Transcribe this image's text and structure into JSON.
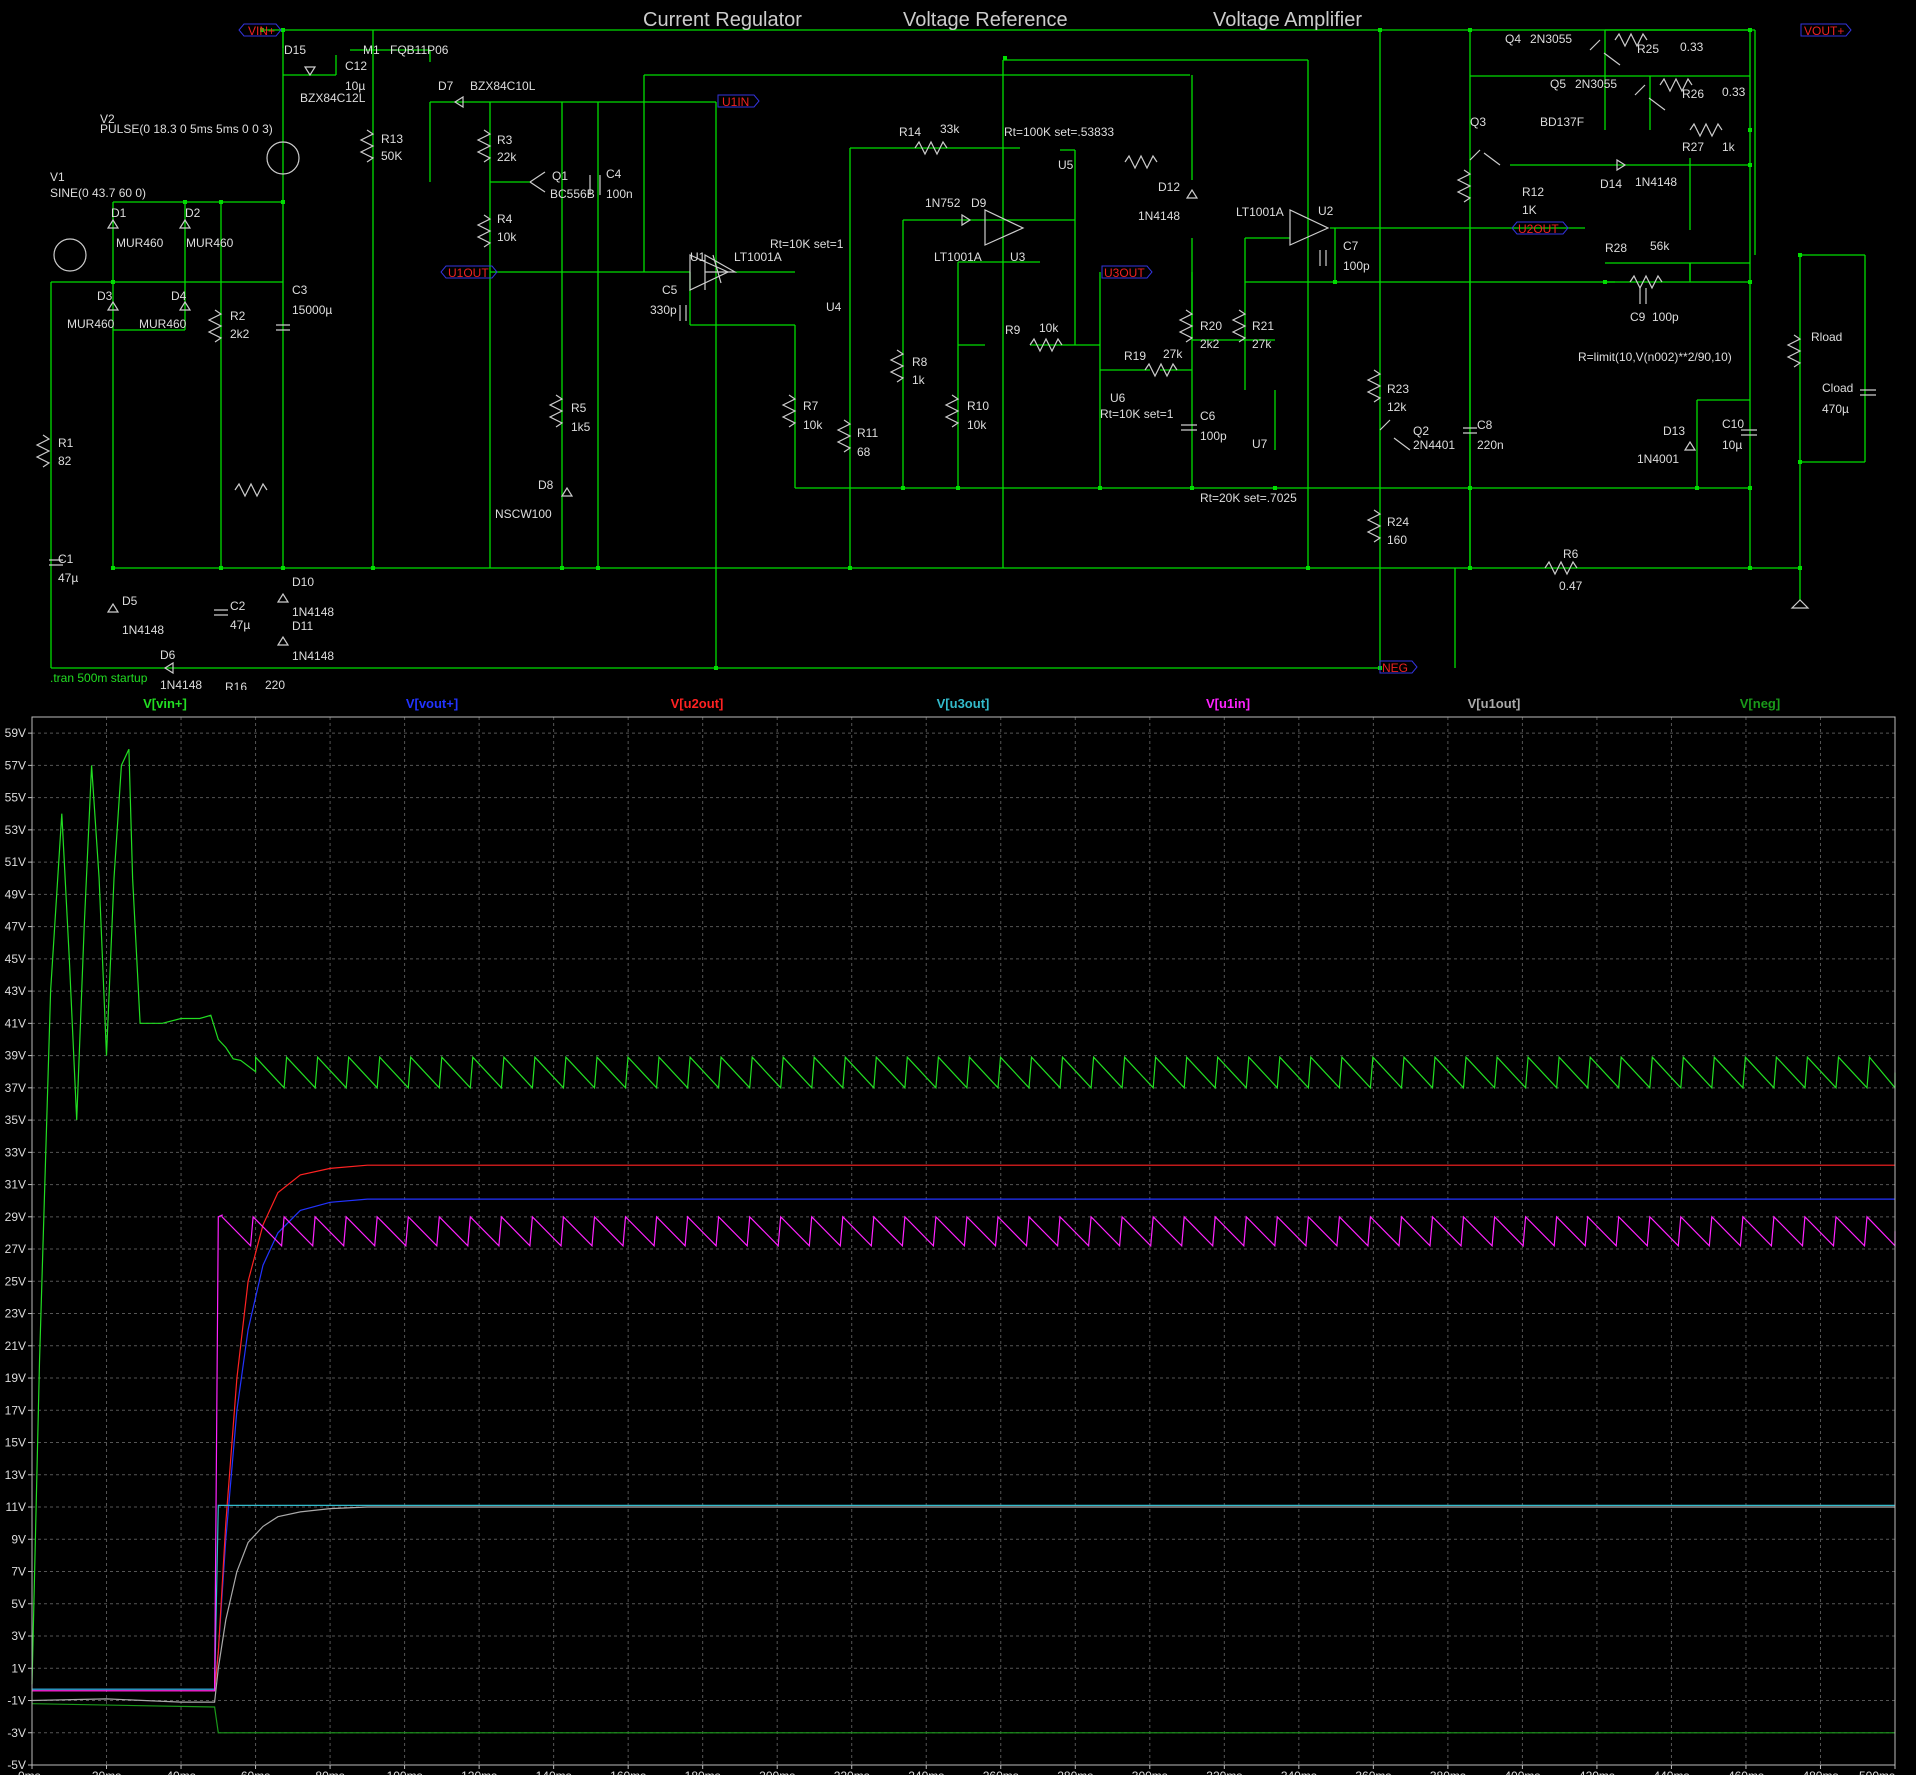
{
  "schematic": {
    "section_titles": [
      "Current Regulator",
      "Voltage Reference",
      "Voltage Amplifier"
    ],
    "net_labels": {
      "vin": "VIN+",
      "vout": "VOUT+",
      "u1in": "U1IN",
      "u1out": "U1OUT",
      "u3out": "U3OUT",
      "u2out": "U2OUT",
      "neg": "NEG"
    },
    "sources": {
      "v1_name": "V1",
      "v1_value": "SINE(0 43.7 60 0)",
      "v2_name": "V2",
      "v2_value": "PULSE(0 18.3 0 5ms 5ms 0 0 3)"
    },
    "components": [
      {
        "name": "D15",
        "value": "BZX84C12L"
      },
      {
        "name": "C12",
        "value": "10µ"
      },
      {
        "name": "M1",
        "value": "FQB11P06"
      },
      {
        "name": "D7",
        "value": "BZX84C10L"
      },
      {
        "name": "R13",
        "value": "50K"
      },
      {
        "name": "D1",
        "value": "MUR460"
      },
      {
        "name": "D2",
        "value": "MUR460"
      },
      {
        "name": "D3",
        "value": "MUR460"
      },
      {
        "name": "D4",
        "value": "MUR460"
      },
      {
        "name": "C3",
        "value": "15000µ"
      },
      {
        "name": "R2",
        "value": "2k2"
      },
      {
        "name": "R1",
        "value": "82"
      },
      {
        "name": "C1",
        "value": "47µ"
      },
      {
        "name": "D5",
        "value": "1N4148"
      },
      {
        "name": "C2",
        "value": "47µ"
      },
      {
        "name": "D10",
        "value": "1N4148"
      },
      {
        "name": "D11",
        "value": "1N4148"
      },
      {
        "name": "D6",
        "value": "1N4148"
      },
      {
        "name": "R16",
        "value": "220"
      },
      {
        "name": "R3",
        "value": "22k"
      },
      {
        "name": "Q1",
        "value": "BC556B"
      },
      {
        "name": "C4",
        "value": "100n"
      },
      {
        "name": "R4",
        "value": "10k"
      },
      {
        "name": "R5",
        "value": "1k5"
      },
      {
        "name": "D8",
        "value": "NSCW100"
      },
      {
        "name": "U1",
        "value": "LT1001A"
      },
      {
        "name": "C5",
        "value": "330p"
      },
      {
        "name": "R7",
        "value": "10k"
      },
      {
        "name": "R14",
        "value": "33k"
      },
      {
        "name": "U5",
        "value": "Rt=100K set=.53833"
      },
      {
        "name": "U4",
        "value": "Rt=10K set=1"
      },
      {
        "name": "R11",
        "value": "68"
      },
      {
        "name": "D9",
        "value": "1N752"
      },
      {
        "name": "U3",
        "value": "LT1001A"
      },
      {
        "name": "R8",
        "value": "1k"
      },
      {
        "name": "R10",
        "value": "10k"
      },
      {
        "name": "R9",
        "value": "10k"
      },
      {
        "name": "U6",
        "value": "Rt=10K set=1"
      },
      {
        "name": "R19",
        "value": "27k"
      },
      {
        "name": "C6",
        "value": "100p"
      },
      {
        "name": "D12",
        "value": "1N4148"
      },
      {
        "name": "R20",
        "value": "2k2"
      },
      {
        "name": "U2",
        "value": "LT1001A"
      },
      {
        "name": "C7",
        "value": "100p"
      },
      {
        "name": "R21",
        "value": "27k"
      },
      {
        "name": "U7",
        "value": "Rt=20K set=.7025"
      },
      {
        "name": "R23",
        "value": "12k"
      },
      {
        "name": "R24",
        "value": "160"
      },
      {
        "name": "Q2",
        "value": "2N4401"
      },
      {
        "name": "C8",
        "value": "220n"
      },
      {
        "name": "Q4",
        "value": "2N3055"
      },
      {
        "name": "R25",
        "value": "0.33"
      },
      {
        "name": "Q5",
        "value": "2N3055"
      },
      {
        "name": "R26",
        "value": "0.33"
      },
      {
        "name": "Q3",
        "value": "BD137F"
      },
      {
        "name": "R27",
        "value": "1k"
      },
      {
        "name": "D14",
        "value": "1N4148"
      },
      {
        "name": "R12",
        "value": "1K"
      },
      {
        "name": "R28",
        "value": "56k"
      },
      {
        "name": "C9",
        "value": "100p"
      },
      {
        "name": "D13",
        "value": "1N4001"
      },
      {
        "name": "C10",
        "value": "10µ"
      },
      {
        "name": "Rload",
        "value": "R=limit(10,V(n002)**2/90,10)"
      },
      {
        "name": "Cload",
        "value": "470µ"
      },
      {
        "name": "R6",
        "value": "0.47"
      }
    ],
    "directive": ".tran 500m startup"
  },
  "chart_data": {
    "type": "line",
    "series": [
      {
        "name": "V[vin+]",
        "color": "#22dd22",
        "x": [
          0,
          2,
          5,
          8,
          10,
          12,
          14,
          16,
          18,
          20,
          22,
          24,
          26,
          27,
          29,
          31,
          35,
          40,
          45,
          48,
          50,
          52,
          54,
          56,
          60
        ],
        "y": [
          0,
          20,
          43,
          54,
          45,
          35,
          47,
          57,
          50,
          39,
          50,
          57,
          58,
          50,
          41,
          41,
          41,
          41.3,
          41.3,
          41.5,
          40,
          39.5,
          38.8,
          38.7,
          38
        ],
        "ripple": {
          "start_ms": 60,
          "period_ms": 8.33,
          "high": 38.9,
          "low": 37.0
        }
      },
      {
        "name": "V[vout+]",
        "color": "#2233ff",
        "x": [
          0,
          20,
          40,
          49,
          50,
          52,
          55,
          58,
          62,
          66,
          72,
          80,
          90,
          100,
          500
        ],
        "y": [
          -0.3,
          -0.3,
          -0.3,
          -0.3,
          2,
          9,
          17,
          22,
          26,
          28,
          29.4,
          29.9,
          30.1,
          30.1,
          30.1
        ]
      },
      {
        "name": "V[u2out]",
        "color": "#ff2222",
        "x": [
          0,
          20,
          40,
          49,
          50,
          52,
          55,
          58,
          62,
          66,
          72,
          80,
          90,
          100,
          500
        ],
        "y": [
          -0.4,
          -0.4,
          -0.4,
          -0.4,
          2,
          10,
          19,
          25,
          28.5,
          30.5,
          31.6,
          32.0,
          32.2,
          32.2,
          32.2
        ]
      },
      {
        "name": "V[u3out]",
        "color": "#33bbcc",
        "x": [
          0,
          49,
          50,
          500
        ],
        "y": [
          -0.3,
          -0.3,
          11.1,
          11.1
        ]
      },
      {
        "name": "V[u1in]",
        "color": "#ff22ff",
        "x": [
          0,
          49,
          50,
          51
        ],
        "y": [
          -0.4,
          -0.4,
          29,
          29.1
        ],
        "ripple": {
          "start_ms": 51,
          "period_ms": 8.33,
          "high": 29.0,
          "low": 27.2
        }
      },
      {
        "name": "V[u1out]",
        "color": "#aaaaaa",
        "x": [
          0,
          20,
          40,
          49,
          50,
          52,
          55,
          58,
          62,
          66,
          72,
          80,
          90,
          500
        ],
        "y": [
          -1,
          -0.9,
          -1.1,
          -1.1,
          1,
          4,
          7,
          8.8,
          9.8,
          10.4,
          10.7,
          10.9,
          11.0,
          11.0
        ]
      },
      {
        "name": "V[neg]",
        "color": "#1a9a1a",
        "x": [
          0,
          49,
          50,
          500
        ],
        "y": [
          -1.2,
          -1.4,
          -3,
          -3
        ]
      }
    ],
    "xlim": [
      0,
      500
    ],
    "ylim": [
      -5,
      60
    ],
    "xticks": [
      0,
      20,
      40,
      60,
      80,
      100,
      120,
      140,
      160,
      180,
      200,
      220,
      240,
      260,
      280,
      300,
      320,
      340,
      360,
      380,
      400,
      420,
      440,
      460,
      480,
      500
    ],
    "xtick_labels": [
      "0ms",
      "20ms",
      "40ms",
      "60ms",
      "80ms",
      "100ms",
      "120ms",
      "140ms",
      "160ms",
      "180ms",
      "200ms",
      "220ms",
      "240ms",
      "260ms",
      "280ms",
      "300ms",
      "320ms",
      "340ms",
      "360ms",
      "380ms",
      "400ms",
      "420ms",
      "440ms",
      "460ms",
      "480ms",
      "500ms"
    ],
    "yticks": [
      -5,
      -3,
      -1,
      1,
      3,
      5,
      7,
      9,
      11,
      13,
      15,
      17,
      19,
      21,
      23,
      25,
      27,
      29,
      31,
      33,
      35,
      37,
      39,
      41,
      43,
      45,
      47,
      49,
      51,
      53,
      55,
      57,
      59
    ],
    "ytick_labels": [
      "-5V",
      "-3V",
      "-1V",
      "1V",
      "3V",
      "5V",
      "7V",
      "9V",
      "11V",
      "13V",
      "15V",
      "17V",
      "19V",
      "21V",
      "23V",
      "25V",
      "27V",
      "29V",
      "31V",
      "33V",
      "35V",
      "37V",
      "39V",
      "41V",
      "43V",
      "45V",
      "47V",
      "49V",
      "51V",
      "53V",
      "55V",
      "57V",
      "59V"
    ],
    "grid": true,
    "legend": "top"
  }
}
